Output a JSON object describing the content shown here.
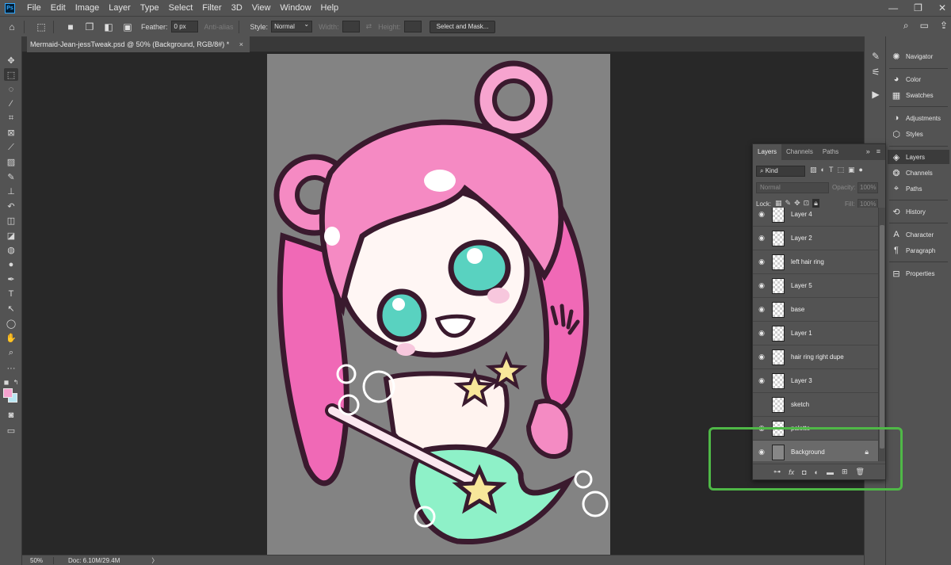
{
  "menu": [
    "File",
    "Edit",
    "Image",
    "Layer",
    "Type",
    "Select",
    "Filter",
    "3D",
    "View",
    "Window",
    "Help"
  ],
  "window_controls": [
    "—",
    "❐",
    "✕"
  ],
  "options": {
    "feather_label": "Feather:",
    "feather_value": "0 px",
    "antialias_label": "Anti-alias",
    "style_label": "Style:",
    "style_value": "Normal",
    "width_label": "Width:",
    "height_label": "Height:",
    "select_mask_label": "Select and Mask..."
  },
  "document_tab": {
    "title": "Mermaid-Jean-jessTweak.psd @ 50% (Background, RGB/8#) *",
    "close": "×"
  },
  "status": {
    "zoom": "50%",
    "doc": "Doc: 6.10M/29.4M",
    "arrow": "〉"
  },
  "panels": [
    {
      "label": "Navigator",
      "icon": "navigator-icon"
    },
    {
      "label": "Color",
      "icon": "color-icon"
    },
    {
      "label": "Swatches",
      "icon": "swatches-icon"
    },
    {
      "label": "Adjustments",
      "icon": "adjustments-icon"
    },
    {
      "label": "Styles",
      "icon": "styles-icon"
    },
    {
      "label": "Layers",
      "icon": "layers-icon"
    },
    {
      "label": "Channels",
      "icon": "channels-icon"
    },
    {
      "label": "Paths",
      "icon": "paths-icon"
    },
    {
      "label": "History",
      "icon": "history-icon"
    },
    {
      "label": "Character",
      "icon": "character-icon"
    },
    {
      "label": "Paragraph",
      "icon": "paragraph-icon"
    },
    {
      "label": "Properties",
      "icon": "properties-icon"
    }
  ],
  "layers_panel": {
    "tabs": [
      "Layers",
      "Channels",
      "Paths"
    ],
    "filter_kind": "Kind",
    "blend_mode": "Normal",
    "opacity_label": "Opacity:",
    "opacity_value": "100%",
    "lock_label": "Lock:",
    "fill_label": "Fill:",
    "fill_value": "100%",
    "layers": [
      {
        "name": "Layer 4",
        "visible": true
      },
      {
        "name": "Layer 2",
        "visible": true
      },
      {
        "name": "left hair ring",
        "visible": true
      },
      {
        "name": "Layer 5",
        "visible": true
      },
      {
        "name": "base",
        "visible": true
      },
      {
        "name": "Layer 1",
        "visible": true
      },
      {
        "name": "hair ring right dupe",
        "visible": true
      },
      {
        "name": "Layer 3",
        "visible": true
      },
      {
        "name": "sketch",
        "visible": false
      },
      {
        "name": "palette",
        "visible": true
      },
      {
        "name": "Background",
        "visible": true,
        "locked": true,
        "selected": true
      }
    ]
  },
  "colors": {
    "foreground": "#f4a2ce",
    "background": "#b9e7f3",
    "highlight": "#4fb847"
  }
}
